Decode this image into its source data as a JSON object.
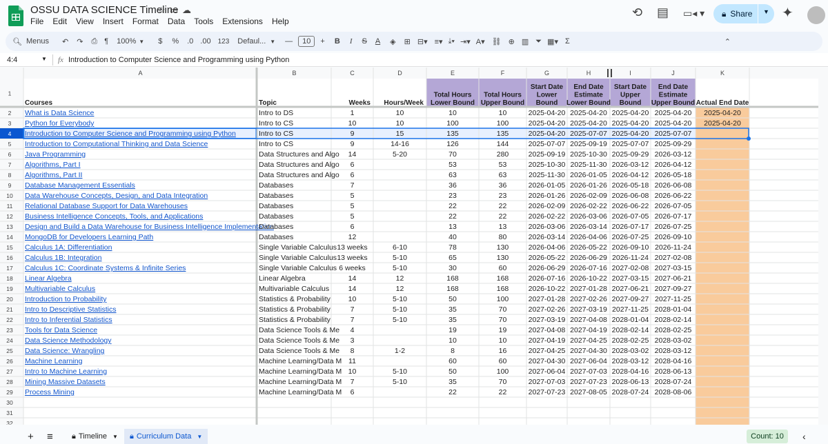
{
  "app": {
    "title": "OSSU DATA SCIENCE Timeline",
    "menu": [
      "File",
      "Edit",
      "View",
      "Insert",
      "Format",
      "Data",
      "Tools",
      "Extensions",
      "Help"
    ],
    "share": "Share"
  },
  "toolbar": {
    "menus": "Menus",
    "zoom": "100%",
    "currency": "$",
    "percent": "%",
    "dec_less": ".0",
    "dec_more": ".00",
    "num_format": "123",
    "font": "Defaul...",
    "font_size": "10",
    "bold": "B",
    "italic": "I"
  },
  "formula": {
    "cell_ref": "4:4",
    "fx": "fx",
    "content": "Introduction to Computer Science and Programming using Python"
  },
  "columns": [
    "A",
    "B",
    "C",
    "D",
    "E",
    "F",
    "G",
    "H",
    "I",
    "J",
    "K"
  ],
  "header_row": [
    "Courses",
    "Topic",
    "Weeks",
    "Hours/Week",
    "Total Hours\nLower Bound",
    "Total Hours\nUpper Bound",
    "Start Date\nLower\nBound",
    "End Date\nEstimate\nLower Bound",
    "Start Date\nUpper\nBound",
    "End Date\nEstimate\nUpper Bound",
    "Actual End Date"
  ],
  "rows": [
    [
      "What is Data Science",
      "Intro to DS",
      "1",
      "10",
      "10",
      "10",
      "2025-04-20",
      "2025-04-20",
      "2025-04-20",
      "2025-04-20",
      "2025-04-20"
    ],
    [
      "Python for Everybody",
      "Intro to CS",
      "10",
      "10",
      "100",
      "100",
      "2025-04-20",
      "2025-04-20",
      "2025-04-20",
      "2025-04-20",
      "2025-04-20"
    ],
    [
      "Introduction to Computer Science and Programming using Python",
      "Intro to CS",
      "9",
      "15",
      "135",
      "135",
      "2025-04-20",
      "2025-07-07",
      "2025-04-20",
      "2025-07-07",
      ""
    ],
    [
      "Introduction to Computational Thinking and Data Science",
      "Intro to CS",
      "9",
      "14-16",
      "126",
      "144",
      "2025-07-07",
      "2025-09-19",
      "2025-07-07",
      "2025-09-29",
      ""
    ],
    [
      "Java Programming",
      "Data Structures and Algo",
      "14",
      "5-20",
      "70",
      "280",
      "2025-09-19",
      "2025-10-30",
      "2025-09-29",
      "2026-03-12",
      ""
    ],
    [
      "Algorithms, Part I",
      "Data Structures and Algo",
      "6",
      "",
      "53",
      "53",
      "2025-10-30",
      "2025-11-30",
      "2026-03-12",
      "2026-04-12",
      ""
    ],
    [
      "Algorithms, Part II",
      "Data Structures and Algo",
      "6",
      "",
      "63",
      "63",
      "2025-11-30",
      "2026-01-05",
      "2026-04-12",
      "2026-05-18",
      ""
    ],
    [
      "Database Management Essentials",
      "Databases",
      "7",
      "",
      "36",
      "36",
      "2026-01-05",
      "2026-01-26",
      "2026-05-18",
      "2026-06-08",
      ""
    ],
    [
      "Data Warehouse Concepts, Design, and Data Integration",
      "Databases",
      "5",
      "",
      "23",
      "23",
      "2026-01-26",
      "2026-02-09",
      "2026-06-08",
      "2026-06-22",
      ""
    ],
    [
      "Relational Database Support for Data Warehouses",
      "Databases",
      "5",
      "",
      "22",
      "22",
      "2026-02-09",
      "2026-02-22",
      "2026-06-22",
      "2026-07-05",
      ""
    ],
    [
      "Business Intelligence Concepts, Tools, and Applications",
      "Databases",
      "5",
      "",
      "22",
      "22",
      "2026-02-22",
      "2026-03-06",
      "2026-07-05",
      "2026-07-17",
      ""
    ],
    [
      "Design and Build a Data Warehouse for Business Intelligence Implementation",
      "Databases",
      "6",
      "",
      "13",
      "13",
      "2026-03-06",
      "2026-03-14",
      "2026-07-17",
      "2026-07-25",
      ""
    ],
    [
      "MongoDB for Developers Learning Path",
      "Databases",
      "12",
      "",
      "40",
      "80",
      "2026-03-14",
      "2026-04-06",
      "2026-07-25",
      "2026-09-10",
      ""
    ],
    [
      "Calculus 1A: Differentiation",
      "Single Variable Calculus",
      "13 weeks",
      "6-10",
      "78",
      "130",
      "2026-04-06",
      "2026-05-22",
      "2026-09-10",
      "2026-11-24",
      ""
    ],
    [
      "Calculus 1B: Integration",
      "Single Variable Calculus",
      "13 weeks",
      "5-10",
      "65",
      "130",
      "2026-05-22",
      "2026-06-29",
      "2026-11-24",
      "2027-02-08",
      ""
    ],
    [
      "Calculus 1C: Coordinate Systems & Infinite Series",
      "Single Variable Calculus",
      "6 weeks",
      "5-10",
      "30",
      "60",
      "2026-06-29",
      "2026-07-16",
      "2027-02-08",
      "2027-03-15",
      ""
    ],
    [
      "Linear Algebra",
      "Linear Algebra",
      "14",
      "12",
      "168",
      "168",
      "2026-07-16",
      "2026-10-22",
      "2027-03-15",
      "2027-06-21",
      ""
    ],
    [
      "Multivariable Calculus",
      "Multivariable Calculus",
      "14",
      "12",
      "168",
      "168",
      "2026-10-22",
      "2027-01-28",
      "2027-06-21",
      "2027-09-27",
      ""
    ],
    [
      "Introduction to Probability",
      "Statistics & Probability",
      "10",
      "5-10",
      "50",
      "100",
      "2027-01-28",
      "2027-02-26",
      "2027-09-27",
      "2027-11-25",
      ""
    ],
    [
      "Intro to Descriptive Statistics",
      "Statistics & Probability",
      "7",
      "5-10",
      "35",
      "70",
      "2027-02-26",
      "2027-03-19",
      "2027-11-25",
      "2028-01-04",
      ""
    ],
    [
      "Intro to Inferential Statistics",
      "Statistics & Probability",
      "7",
      "5-10",
      "35",
      "70",
      "2027-03-19",
      "2027-04-08",
      "2028-01-04",
      "2028-02-14",
      ""
    ],
    [
      "Tools for Data Science",
      "Data Science Tools & Me",
      "4",
      "",
      "19",
      "19",
      "2027-04-08",
      "2027-04-19",
      "2028-02-14",
      "2028-02-25",
      ""
    ],
    [
      "Data Science Methodology",
      "Data Science Tools & Me",
      "3",
      "",
      "10",
      "10",
      "2027-04-19",
      "2027-04-25",
      "2028-02-25",
      "2028-03-02",
      ""
    ],
    [
      "Data Science: Wrangling",
      "Data Science Tools & Me",
      "8",
      "1-2",
      "8",
      "16",
      "2027-04-25",
      "2027-04-30",
      "2028-03-02",
      "2028-03-12",
      ""
    ],
    [
      "Machine Learning",
      "Machine Learning/Data M",
      "11",
      "",
      "60",
      "60",
      "2027-04-30",
      "2027-06-04",
      "2028-03-12",
      "2028-04-16",
      ""
    ],
    [
      "Intro to Machine Learning",
      "Machine Learning/Data M",
      "10",
      "5-10",
      "50",
      "100",
      "2027-06-04",
      "2027-07-03",
      "2028-04-16",
      "2028-06-13",
      ""
    ],
    [
      "Mining Massive Datasets",
      "Machine Learning/Data M",
      "7",
      "5-10",
      "35",
      "70",
      "2027-07-03",
      "2027-07-23",
      "2028-06-13",
      "2028-07-24",
      ""
    ],
    [
      "Process Mining",
      "Machine Learning/Data M",
      "6",
      "",
      "22",
      "22",
      "2027-07-23",
      "2027-08-05",
      "2028-07-24",
      "2028-08-06",
      ""
    ]
  ],
  "extra_rows": [
    "30",
    "31",
    "32"
  ],
  "tabs": {
    "add": "+",
    "list": "≡",
    "timeline": "Timeline",
    "curriculum": "Curriculum Data"
  },
  "status": {
    "count": "Count: 10"
  },
  "colors": {
    "header_purple": "#b4a7d6",
    "header_blue": "#9fc5f8",
    "orange": "#f9cb9c",
    "link": "#1155cc",
    "select": "#e8f0fe",
    "accent": "#1a73e8"
  }
}
